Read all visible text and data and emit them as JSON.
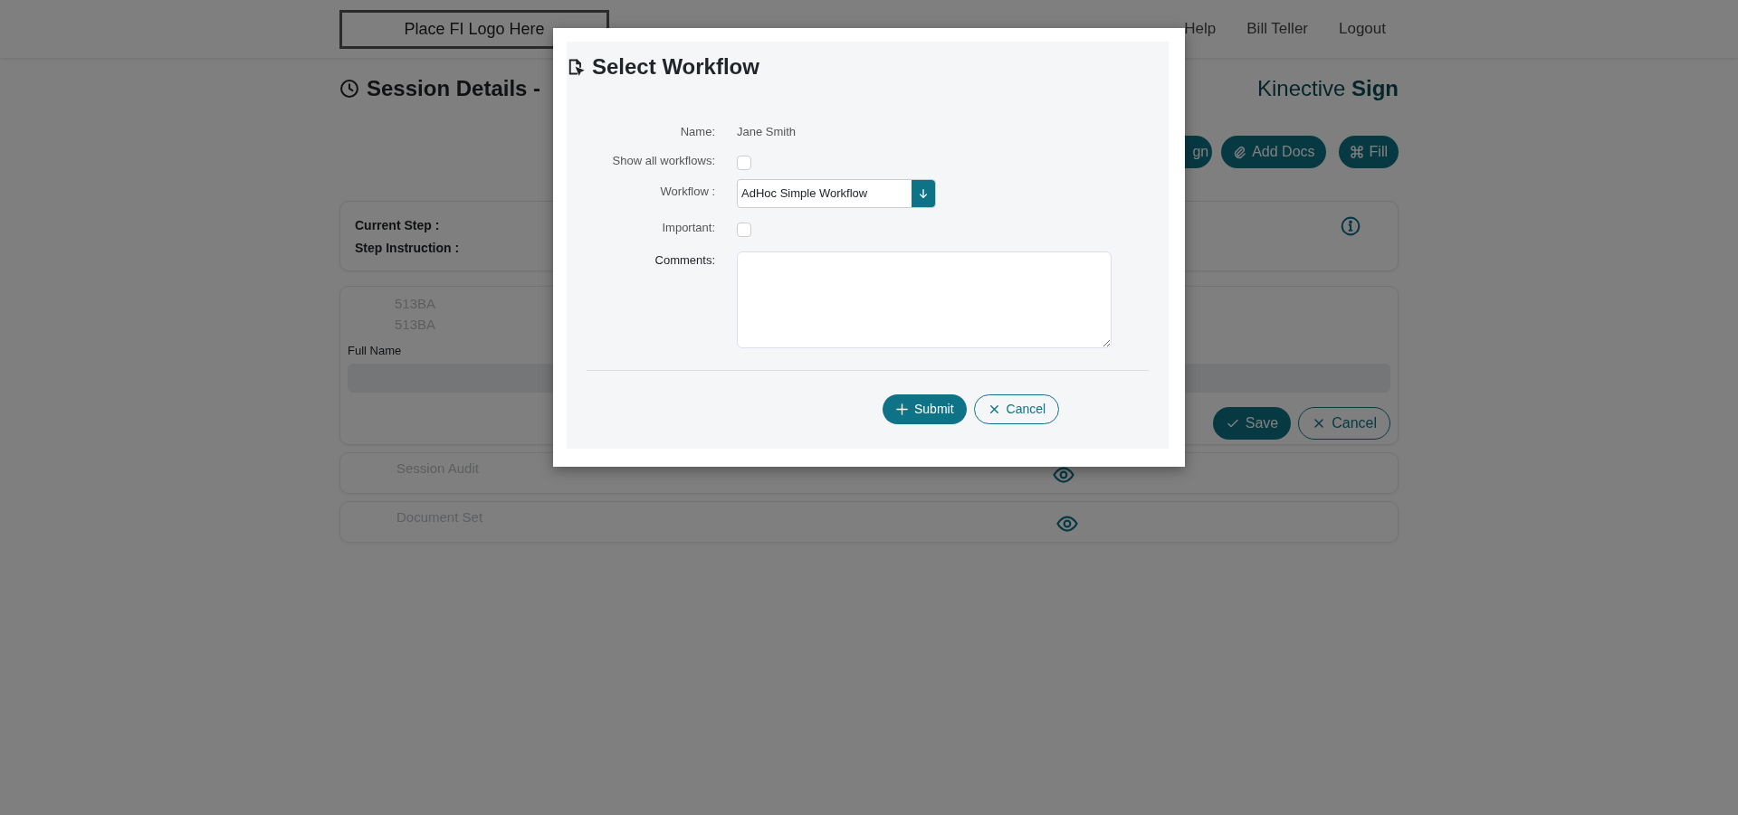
{
  "header": {
    "logo": "Place FI Logo Here",
    "nav": [
      "Help",
      "Bill Teller",
      "Logout"
    ]
  },
  "page": {
    "title": "Session Details -",
    "brand": "Kinective **Sign**",
    "actions": [
      {
        "label": "gn",
        "kind": "plain"
      },
      {
        "label": "Add Docs",
        "kind": "attach"
      },
      {
        "label": "Fill",
        "kind": "fill"
      }
    ],
    "step_card": {
      "labels": [
        "Current Step :",
        "Step Instruction :"
      ]
    },
    "record_card": {
      "codes": [
        "513BA",
        "513BA"
      ],
      "field_label": "Full Name",
      "buttons": [
        {
          "label": "Save",
          "kind": "primary"
        },
        {
          "label": "Cancel",
          "kind": "outline"
        }
      ]
    },
    "sections": [
      {
        "title": "Session Audit"
      },
      {
        "title": "Document Set"
      }
    ]
  },
  "modal": {
    "title": "Select Workflow",
    "fields": [
      {
        "kind": "text",
        "label": "Name:",
        "value": "Jane Smith"
      },
      {
        "kind": "checkbox",
        "label": "Show all workflows:",
        "checked": false
      },
      {
        "kind": "select",
        "label": "Workflow :",
        "value": "AdHoc Simple Workflow"
      },
      {
        "kind": "checkbox",
        "label": "Important:",
        "checked": false
      },
      {
        "kind": "textarea",
        "label": "Comments:"
      }
    ],
    "buttons": [
      {
        "label": "Submit",
        "kind": "primary"
      },
      {
        "label": "Cancel",
        "kind": "outline"
      }
    ]
  }
}
